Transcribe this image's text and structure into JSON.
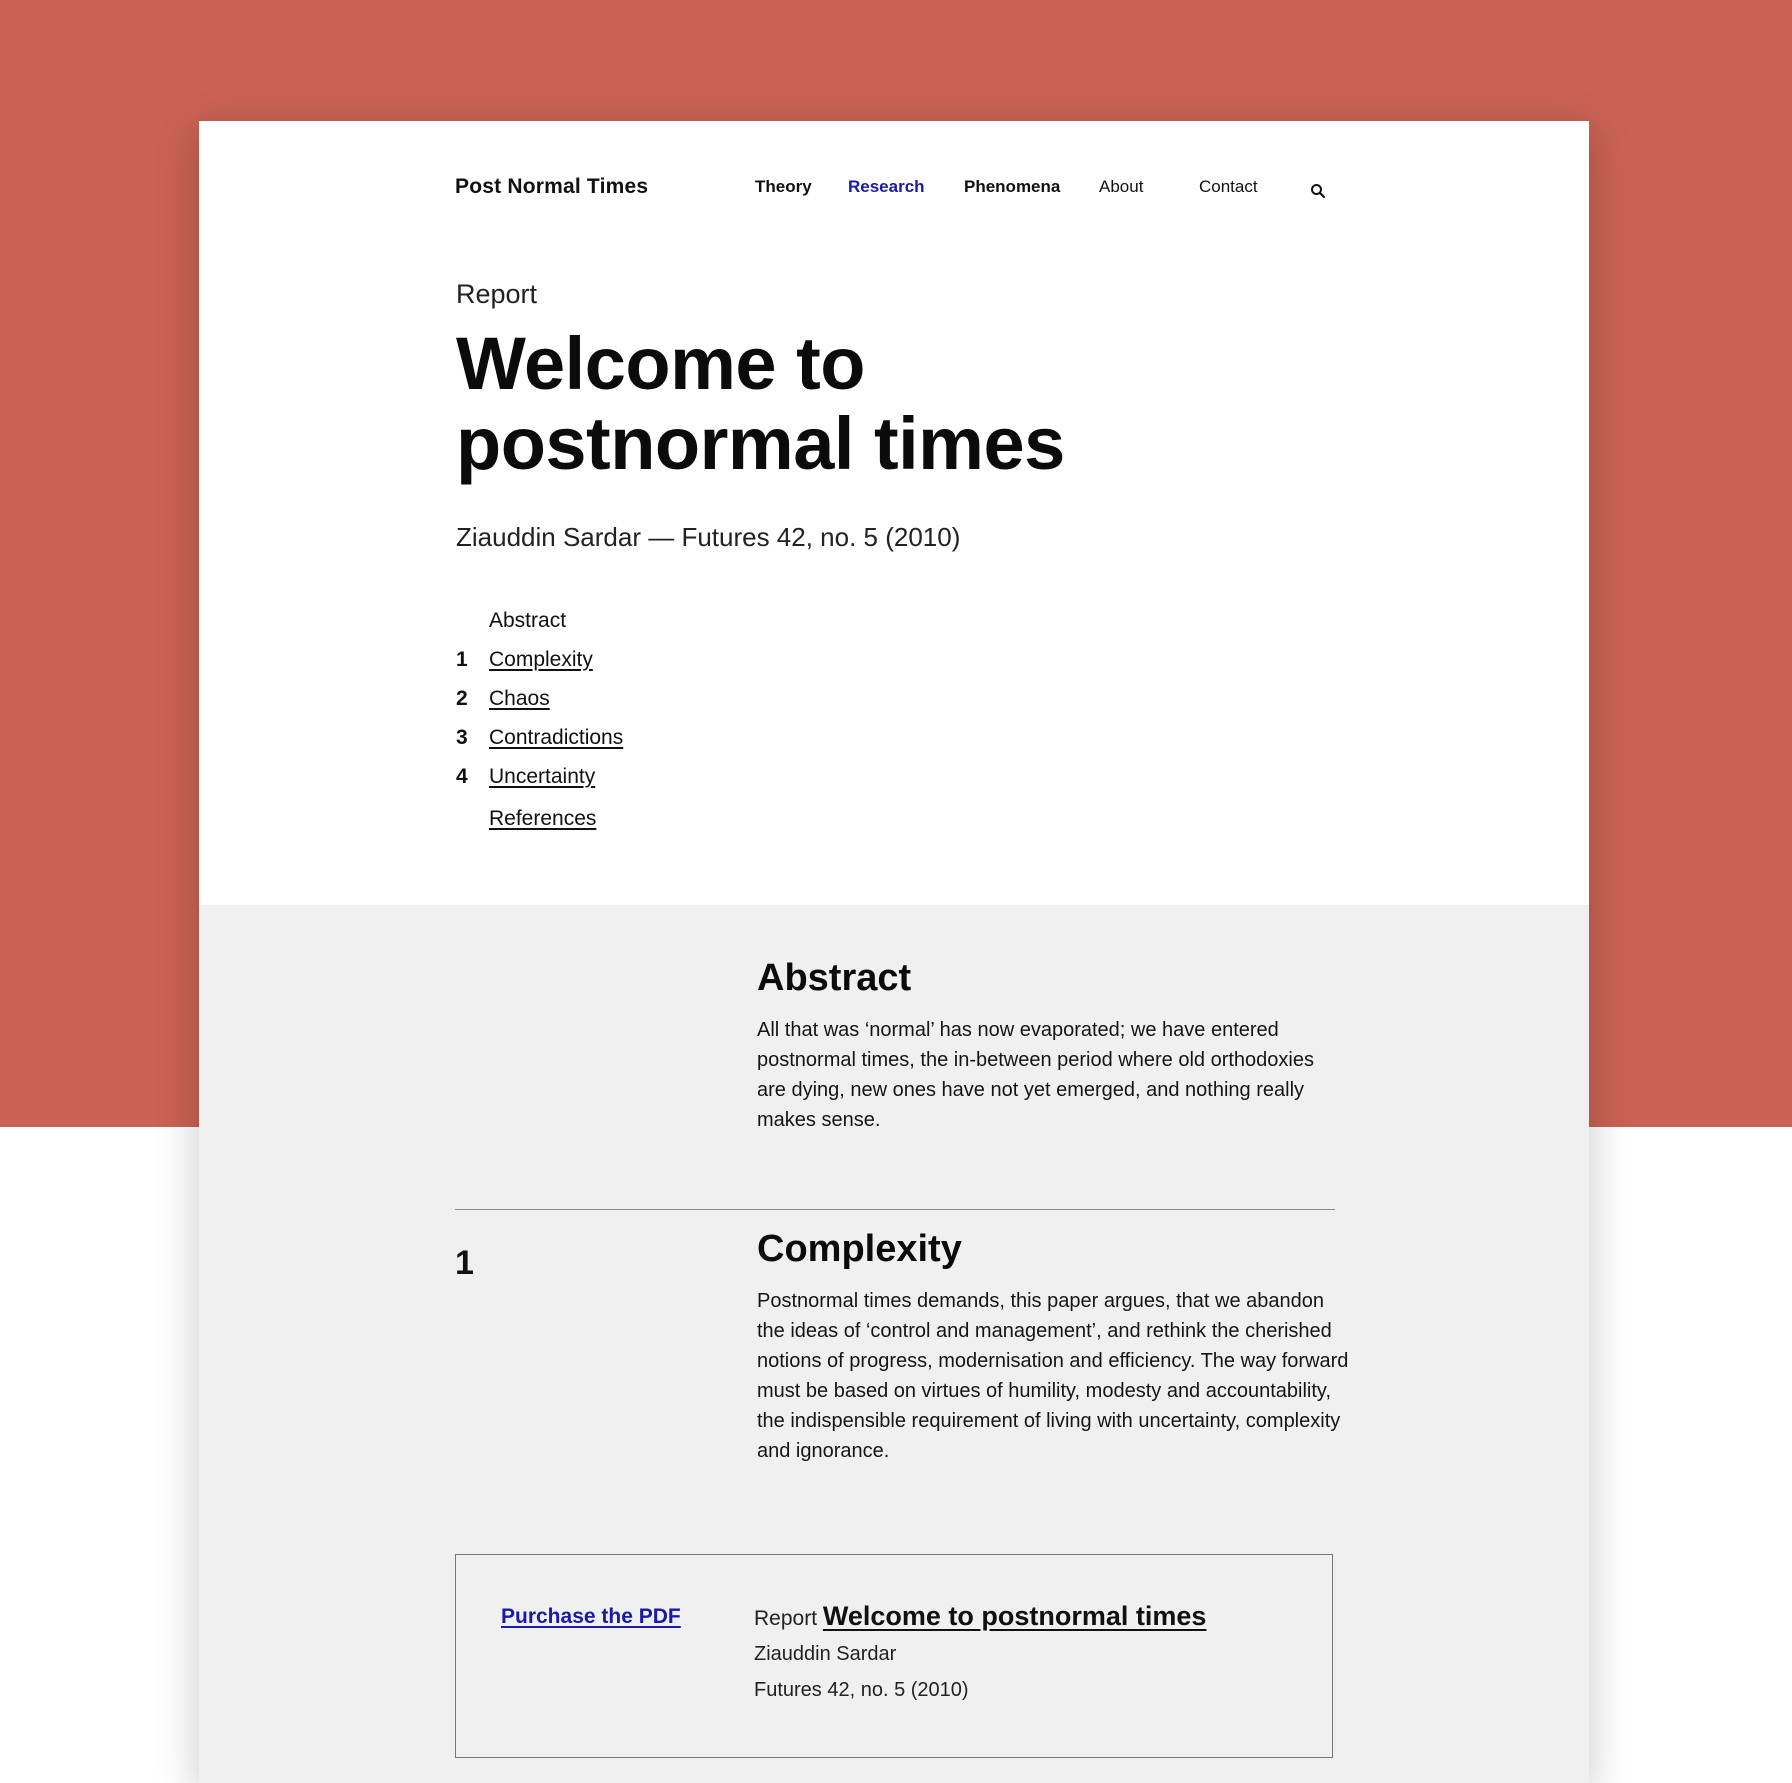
{
  "site": {
    "title": "Post Normal Times"
  },
  "nav": {
    "items": [
      {
        "label": "Theory"
      },
      {
        "label": "Research"
      },
      {
        "label": "Phenomena"
      },
      {
        "label": "About"
      },
      {
        "label": "Contact"
      }
    ],
    "active": "Research",
    "search_icon": "search-icon"
  },
  "article": {
    "kicker": "Report",
    "title": "Welcome to postnormal times",
    "byline": "Ziauddin Sardar — Futures 42, no. 5 (2010)"
  },
  "toc": [
    {
      "num": "",
      "label": "Abstract"
    },
    {
      "num": "1",
      "label": "Complexity"
    },
    {
      "num": "2",
      "label": "Chaos"
    },
    {
      "num": "3",
      "label": "Contradictions"
    },
    {
      "num": "4",
      "label": "Uncertainty"
    },
    {
      "num": "",
      "label": "References"
    }
  ],
  "abstract": {
    "heading": "Abstract",
    "body": "All that was ‘normal’ has now evaporated; we have entered postnormal times, the in-between period where old orthodoxies are dying, new ones have not yet emerged, and nothing really makes sense."
  },
  "sections": [
    {
      "num": "1",
      "heading": "Complexity",
      "body": "Postnormal times demands, this paper argues, that we abandon the ideas of ‘control and management’, and rethink the cherished notions of progress, modernisation and efficiency. The way forward must be based on virtues of humility, modesty and accountability, the indispensible requirement of living with uncertainty, complexity and ignorance."
    }
  ],
  "reference": {
    "purchase_label": "Purchase the PDF",
    "kicker": "Report",
    "title": "Welcome to postnormal times",
    "author": "Ziauddin Sardar",
    "citation": "Futures 42, no. 5 (2010)"
  },
  "colors": {
    "background_band": "#c96254",
    "link_accent": "#1a1aa6",
    "section_grey": "#f0f0f0"
  }
}
